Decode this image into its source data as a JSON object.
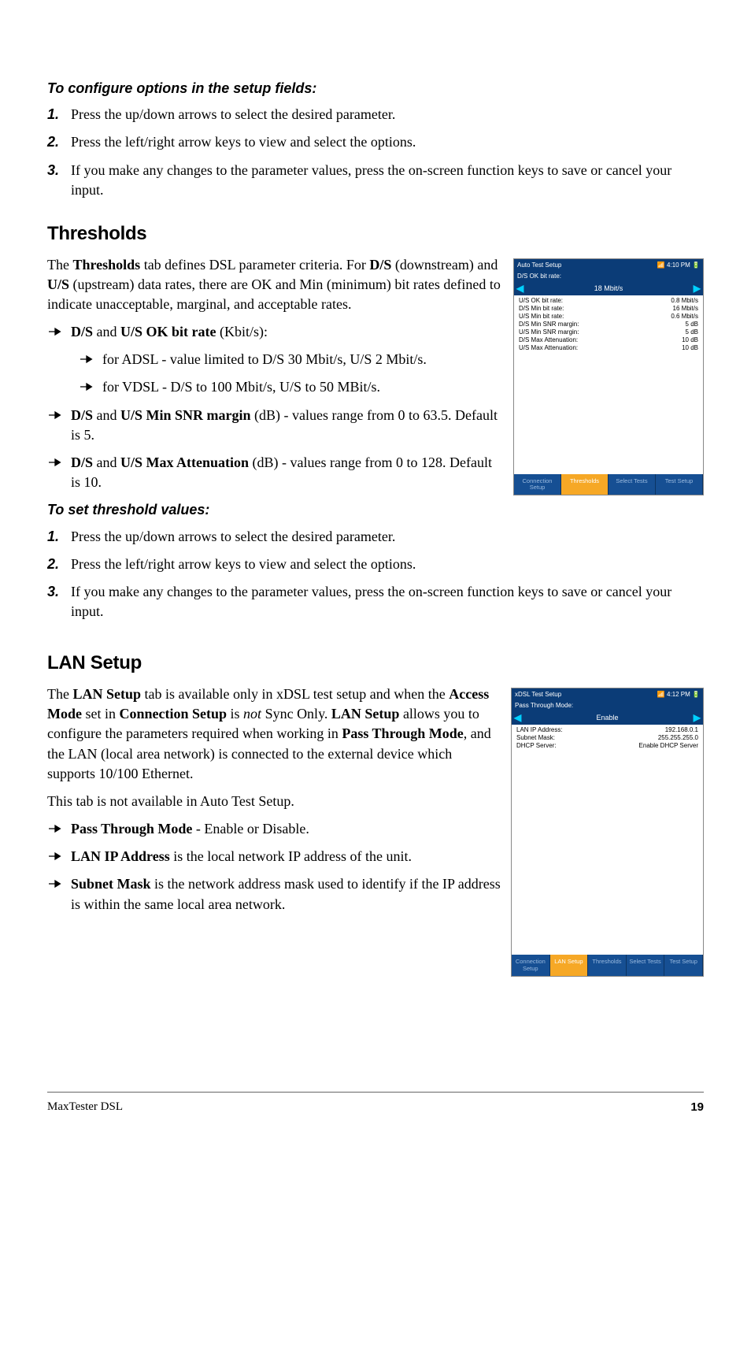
{
  "configHeading": "To configure options in the setup fields:",
  "configSteps": [
    "Press the up/down arrows to select the desired parameter.",
    "Press the left/right arrow keys to view and select the options.",
    "If you make any changes to the parameter values, press the on-screen function keys to save or cancel your input."
  ],
  "thresholds": {
    "title": "Thresholds",
    "intro": {
      "pre1": "The ",
      "b1": "Thresholds",
      "post1": " tab defines DSL parameter criteria. For ",
      "b2": "D/S",
      "mid2": " (downstream) and ",
      "b3": "U/S",
      "post2": " (upstream) data rates, there are OK and Min (minimum) bit rates defined to indicate unacceptable, marginal, and acceptable rates."
    },
    "bullets": {
      "okbit_pre": "",
      "okbit_b1": "D/S",
      "okbit_mid": " and ",
      "okbit_b2": "U/S OK bit rate",
      "okbit_post": " (Kbit/s):",
      "sub1": "for ADSL - value limited to D/S 30 Mbit/s, U/S 2 Mbit/s.",
      "sub2": "for VDSL - D/S to 100 Mbit/s, U/S to 50 MBit/s.",
      "snr_b1": "D/S",
      "snr_mid": " and ",
      "snr_b2": "U/S Min SNR margin",
      "snr_post": " (dB) - values range from 0 to 63.5. Default is 5.",
      "att_b1": "D/S",
      "att_mid": " and ",
      "att_b2": "U/S Max Attenuation",
      "att_post": " (dB) - values range from 0 to 128. Default is 10."
    },
    "setHeading": "To set threshold values:",
    "setSteps": [
      "Press the up/down arrows to select the desired parameter.",
      "Press the left/right arrow keys to view and select the options.",
      "If you make any changes to the parameter values, press the on-screen function keys to save or cancel your input."
    ]
  },
  "lan": {
    "title": "LAN Setup",
    "p1": {
      "pre": "The ",
      "b1": "LAN Setup",
      "t1": " tab is available only in xDSL test setup and when the ",
      "b2": "Access Mode",
      "t2": " set in ",
      "b3": "Connection Setup",
      "t3": " is ",
      "i": "not",
      "t4": " Sync Only. ",
      "b4": "LAN Setup",
      "t5": " allows you to configure the parameters required when working in ",
      "b5": "Pass Through Mode",
      "t6": ", and the LAN (local area network) is connected to the external device which supports 10/100 Ethernet."
    },
    "p2": "This tab is not available in Auto Test Setup.",
    "bul_ptm_b": "Pass Through Mode",
    "bul_ptm_t": " - Enable or Disable.",
    "bul_ip_b": "LAN IP Address",
    "bul_ip_t": " is the local network IP address of the unit.",
    "bul_sm_b": "Subnet Mask",
    "bul_sm_t": " is the network address mask used to identify if the IP address is within the same local area network."
  },
  "shot1": {
    "title": "Auto Test Setup",
    "time": "4:10 PM",
    "fieldLabel": "D/S OK bit rate:",
    "fieldValue": "18 Mbit/s",
    "rows": [
      {
        "l": "U/S OK bit rate:",
        "v": "0.8 Mbit/s"
      },
      {
        "l": "D/S Min bit rate:",
        "v": "16 Mbit/s"
      },
      {
        "l": "U/S Min bit rate:",
        "v": "0.6 Mbit/s"
      },
      {
        "l": "D/S Min SNR margin:",
        "v": "5 dB"
      },
      {
        "l": "U/S Min SNR margin:",
        "v": "5 dB"
      },
      {
        "l": "D/S Max Attenuation:",
        "v": "10 dB"
      },
      {
        "l": "U/S Max Attenuation:",
        "v": "10 dB"
      }
    ],
    "tabs": [
      "Connection Setup",
      "Thresholds",
      "Select Tests",
      "Test Setup"
    ]
  },
  "shot2": {
    "title": "xDSL Test Setup",
    "time": "4:12 PM",
    "fieldLabel": "Pass Through Mode:",
    "fieldValue": "Enable",
    "rows": [
      {
        "l": "LAN IP Address:",
        "v": "192.168.0.1"
      },
      {
        "l": "Subnet Mask:",
        "v": "255.255.255.0"
      },
      {
        "l": "DHCP Server:",
        "v": "Enable DHCP Server"
      }
    ],
    "tabs": [
      "Connection Setup",
      "LAN Setup",
      "Thresholds",
      "Select Tests",
      "Test Setup"
    ]
  },
  "footer": {
    "left": "MaxTester DSL",
    "right": "19"
  }
}
